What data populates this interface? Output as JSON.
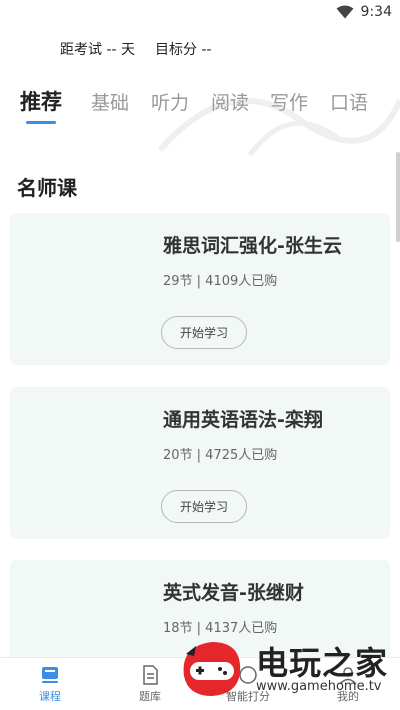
{
  "status_bar": {
    "time": "9:34"
  },
  "header": {
    "exam_countdown": "距考试 -- 天",
    "target_score": "目标分 --"
  },
  "tabs": [
    {
      "label": "推荐",
      "active": true
    },
    {
      "label": "基础",
      "active": false
    },
    {
      "label": "听力",
      "active": false
    },
    {
      "label": "阅读",
      "active": false
    },
    {
      "label": "写作",
      "active": false
    },
    {
      "label": "口语",
      "active": false
    }
  ],
  "section": {
    "title": "名师课"
  },
  "courses": [
    {
      "title": "雅思词汇强化-张生云",
      "meta": "29节 | 4109人已购",
      "button": "开始学习"
    },
    {
      "title": "通用英语语法-栾翔",
      "meta": "20节 | 4725人已购",
      "button": "开始学习"
    },
    {
      "title": "英式发音-张继财",
      "meta": "18节 | 4137人已购",
      "button": "开始学习"
    }
  ],
  "bottom_nav": [
    {
      "label": "课程",
      "icon": "course-icon",
      "active": true
    },
    {
      "label": "题库",
      "icon": "question-bank-icon",
      "active": false
    },
    {
      "label": "智能打分",
      "icon": "smart-score-icon",
      "active": false
    },
    {
      "label": "我的",
      "icon": "profile-icon",
      "active": false
    }
  ],
  "watermark": {
    "brand": "电玩之家",
    "url": "www.gamehome.tv"
  },
  "colors": {
    "accent": "#3a8ee6",
    "card_bg": "#f1f8f6",
    "logo_red": "#e5262a"
  }
}
